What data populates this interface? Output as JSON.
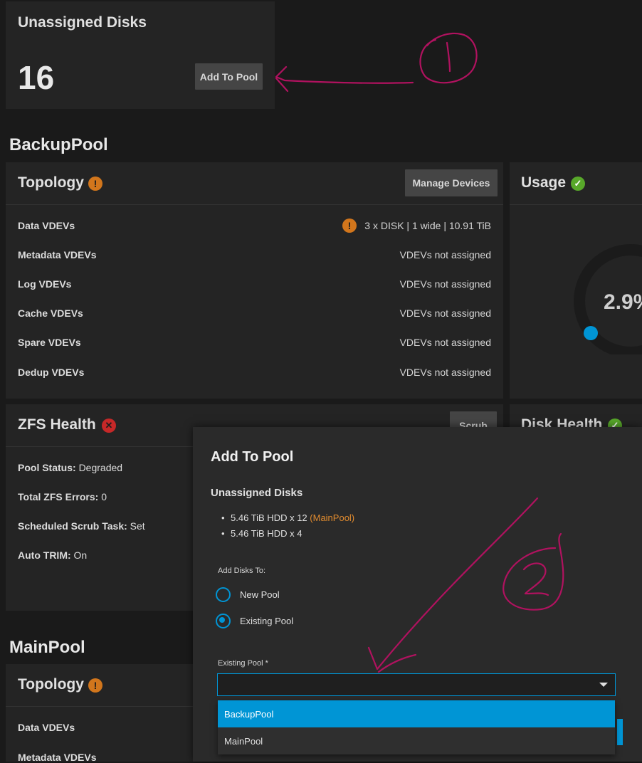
{
  "unassigned": {
    "title": "Unassigned Disks",
    "count": "16",
    "add_button": "Add To Pool"
  },
  "backup_pool": {
    "name": "BackupPool",
    "topology": {
      "title": "Topology",
      "manage_button": "Manage Devices",
      "rows": [
        {
          "label": "Data VDEVs",
          "value": "3 x DISK | 1 wide | 10.91 TiB"
        },
        {
          "label": "Metadata VDEVs",
          "value": "VDEVs not assigned"
        },
        {
          "label": "Log VDEVs",
          "value": "VDEVs not assigned"
        },
        {
          "label": "Cache VDEVs",
          "value": "VDEVs not assigned"
        },
        {
          "label": "Spare VDEVs",
          "value": "VDEVs not assigned"
        },
        {
          "label": "Dedup VDEVs",
          "value": "VDEVs not assigned"
        }
      ]
    },
    "usage": {
      "title": "Usage",
      "percent": "2.9%"
    },
    "zfs_health": {
      "title": "ZFS Health",
      "scrub_button": "Scrub",
      "pool_status_label": "Pool Status:",
      "pool_status_value": "Degraded",
      "errors_label": "Total ZFS Errors:",
      "errors_value": "0",
      "scrub_task_label": "Scheduled Scrub Task:",
      "scrub_task_value": "Set",
      "trim_label": "Auto TRIM:",
      "trim_value": "On"
    },
    "disk_health": {
      "title": "Disk Health"
    }
  },
  "main_pool": {
    "name": "MainPool",
    "topology": {
      "title": "Topology",
      "rows": [
        {
          "label": "Data VDEVs"
        },
        {
          "label": "Metadata VDEVs"
        }
      ]
    }
  },
  "dialog": {
    "title": "Add To Pool",
    "subtitle": "Unassigned Disks",
    "disk_items": [
      {
        "text": "5.46 TiB HDD x 12",
        "tag": "(MainPool)"
      },
      {
        "text": "5.46 TiB HDD x 4",
        "tag": ""
      }
    ],
    "add_disks_to_label": "Add Disks To:",
    "radio_options": [
      "New Pool",
      "Existing Pool"
    ],
    "selected_radio": "Existing Pool",
    "existing_pool_label": "Existing Pool *",
    "existing_pool_value": "",
    "dropdown_options": [
      "BackupPool",
      "MainPool"
    ],
    "highlighted_option": "BackupPool"
  },
  "annotations": {
    "step_1": "1",
    "step_2": "2"
  },
  "colors": {
    "accent_blue": "#0095d5",
    "warning_orange": "#d2761c",
    "ok_green": "#58a82a",
    "error_red": "#c62828",
    "annotation_magenta": "#b0125f",
    "pool_tag_orange": "#e08b2f"
  },
  "icons": {
    "topology_status": "warning-icon",
    "usage_status": "check-icon",
    "zfs_health_status": "error-icon",
    "disk_health_status": "check-icon",
    "dropdown": "chevron-down-icon"
  }
}
